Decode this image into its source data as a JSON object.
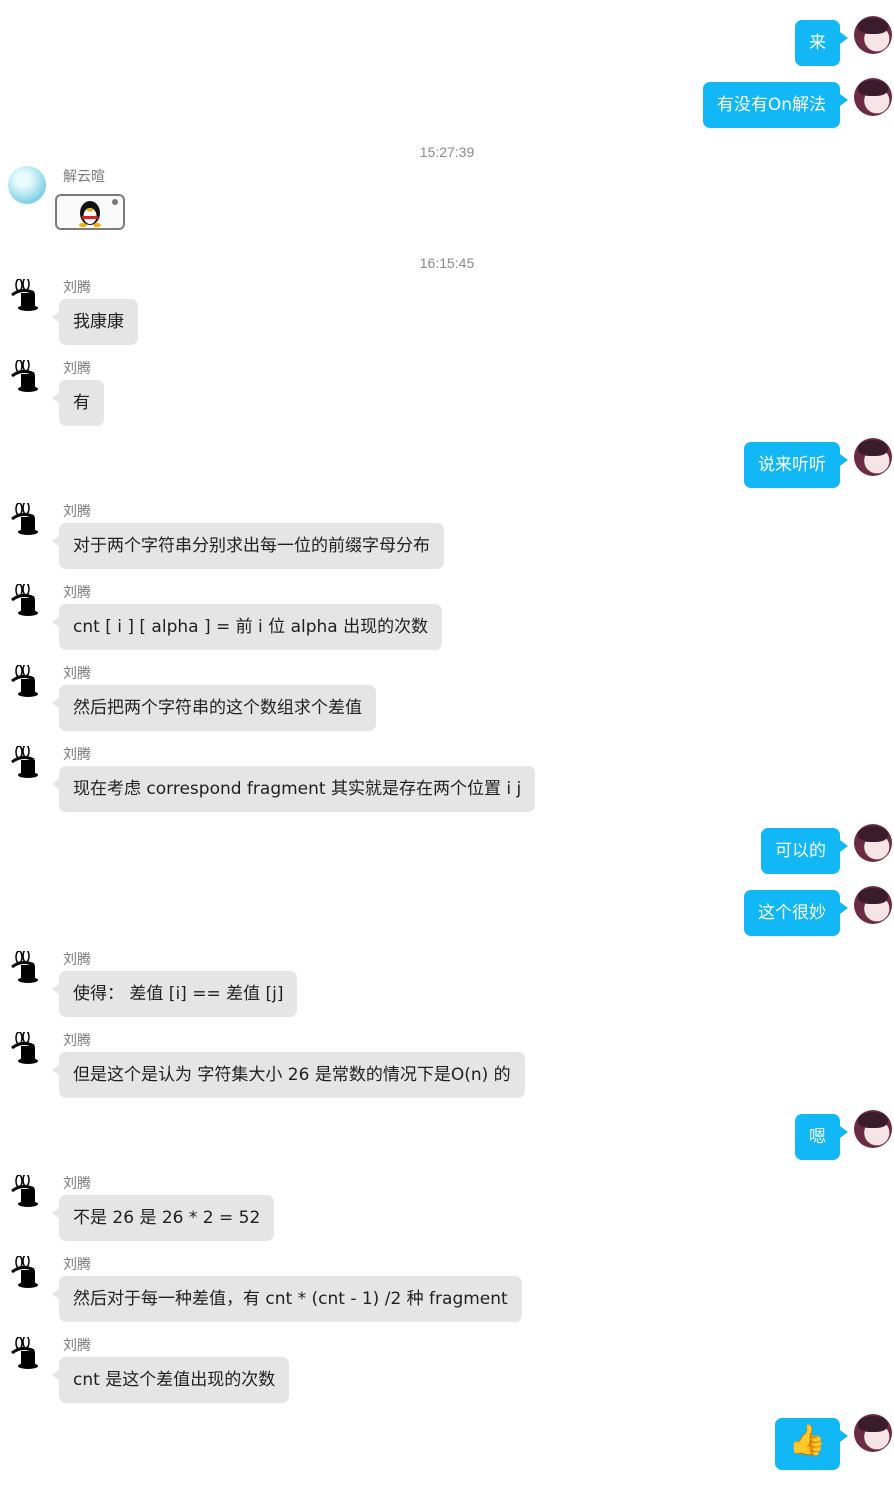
{
  "chat": {
    "peer_name_1": "解云暄",
    "peer_name_2": "刘腾",
    "timestamps": [
      "15:27:39",
      "16:15:45"
    ]
  },
  "messages": [
    {
      "from": "self",
      "text": "来"
    },
    {
      "from": "self",
      "text": "有没有On解法"
    },
    {
      "from": "解云暄",
      "sticker": "qq-penguin-sticker"
    },
    {
      "from": "刘腾",
      "text": "我康康"
    },
    {
      "from": "刘腾",
      "text": "有"
    },
    {
      "from": "self",
      "text": "说来听听"
    },
    {
      "from": "刘腾",
      "text": "对于两个字符串分别求出每一位的前缀字母分布"
    },
    {
      "from": "刘腾",
      "text": "cnt [ i ] [ alpha ] = 前 i 位 alpha 出现的次数"
    },
    {
      "from": "刘腾",
      "text": "然后把两个字符串的这个数组求个差值"
    },
    {
      "from": "刘腾",
      "text": "现在考虑 correspond fragment 其实就是存在两个位置 i  j"
    },
    {
      "from": "self",
      "text": "可以的"
    },
    {
      "from": "self",
      "text": "这个很妙"
    },
    {
      "from": "刘腾",
      "text": "使得：  差值 [i]  == 差值 [j]"
    },
    {
      "from": "刘腾",
      "text": "但是这个是认为 字符集大小 26 是常数的情况下是O(n) 的"
    },
    {
      "from": "self",
      "text": "嗯"
    },
    {
      "from": "刘腾",
      "text": "不是 26 是 26 * 2 = 52"
    },
    {
      "from": "刘腾",
      "text": "然后对于每一种差值，有 cnt * (cnt - 1) /2 种 fragment"
    },
    {
      "from": "刘腾",
      "text": "cnt 是这个差值出现的次数"
    },
    {
      "from": "self",
      "emoji": "👍"
    }
  ],
  "colors": {
    "self_bubble": "#12b7f5",
    "peer_bubble": "#e5e5e5"
  }
}
